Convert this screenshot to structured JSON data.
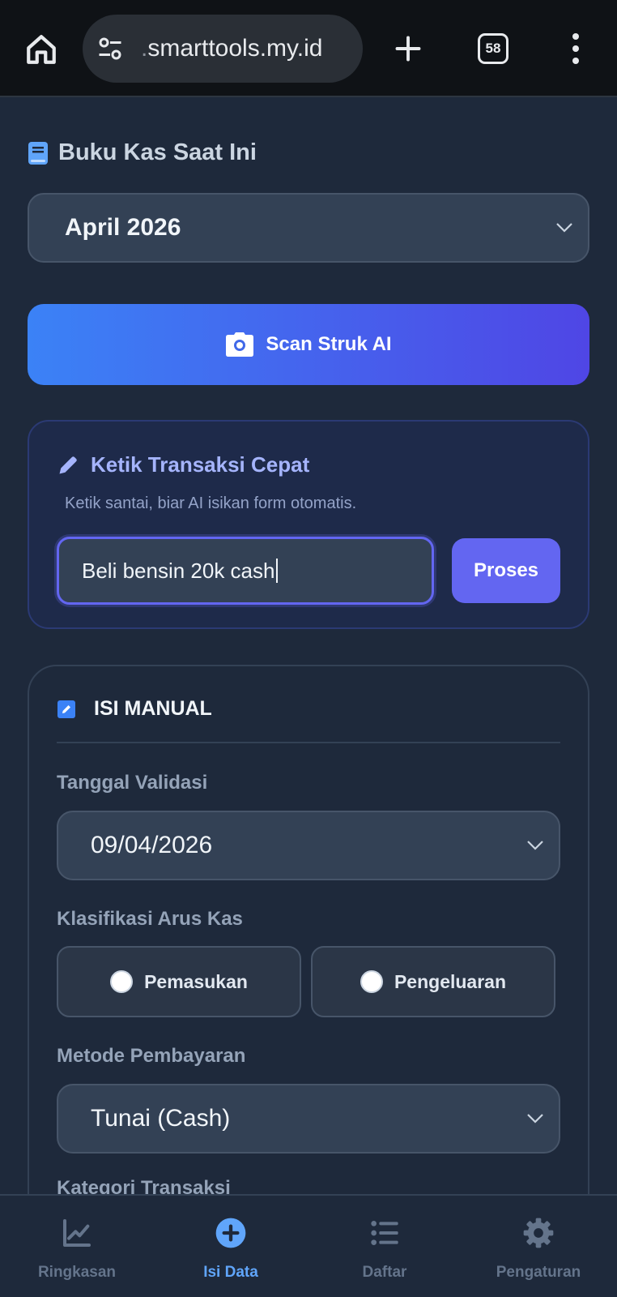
{
  "browser": {
    "url_prefix": ".",
    "url": "smarttools.my.id",
    "tab_count": "58"
  },
  "page": {
    "book_title": "Buku Kas Saat Ini",
    "book_selected": "April 2026",
    "scan_button": "Scan Struk AI",
    "quick": {
      "title": "Ketik Transaksi Cepat",
      "subtitle": "Ketik santai, biar AI isikan form otomatis.",
      "input_value": "Beli bensin 20k cash",
      "process_button": "Proses"
    },
    "manual": {
      "title": "ISI MANUAL",
      "date_label": "Tanggal Validasi",
      "date_value": "09/04/2026",
      "flow_label": "Klasifikasi Arus Kas",
      "flow_options": [
        "Pemasukan",
        "Pengeluaran"
      ],
      "method_label": "Metode Pembayaran",
      "method_value": "Tunai (Cash)",
      "category_label": "Kategori Transaksi"
    }
  },
  "nav": {
    "items": [
      {
        "label": "Ringkasan",
        "icon": "chart-line-icon"
      },
      {
        "label": "Isi Data",
        "icon": "plus-circle-icon"
      },
      {
        "label": "Daftar",
        "icon": "list-icon"
      },
      {
        "label": "Pengaturan",
        "icon": "gear-icon"
      }
    ],
    "active": "Isi Data"
  },
  "colors": {
    "background": "#1e293b",
    "accent": "#6366f1",
    "active_nav": "#60a5fa",
    "scan_gradient_start": "#3b82f6",
    "scan_gradient_end": "#4f46e5"
  }
}
